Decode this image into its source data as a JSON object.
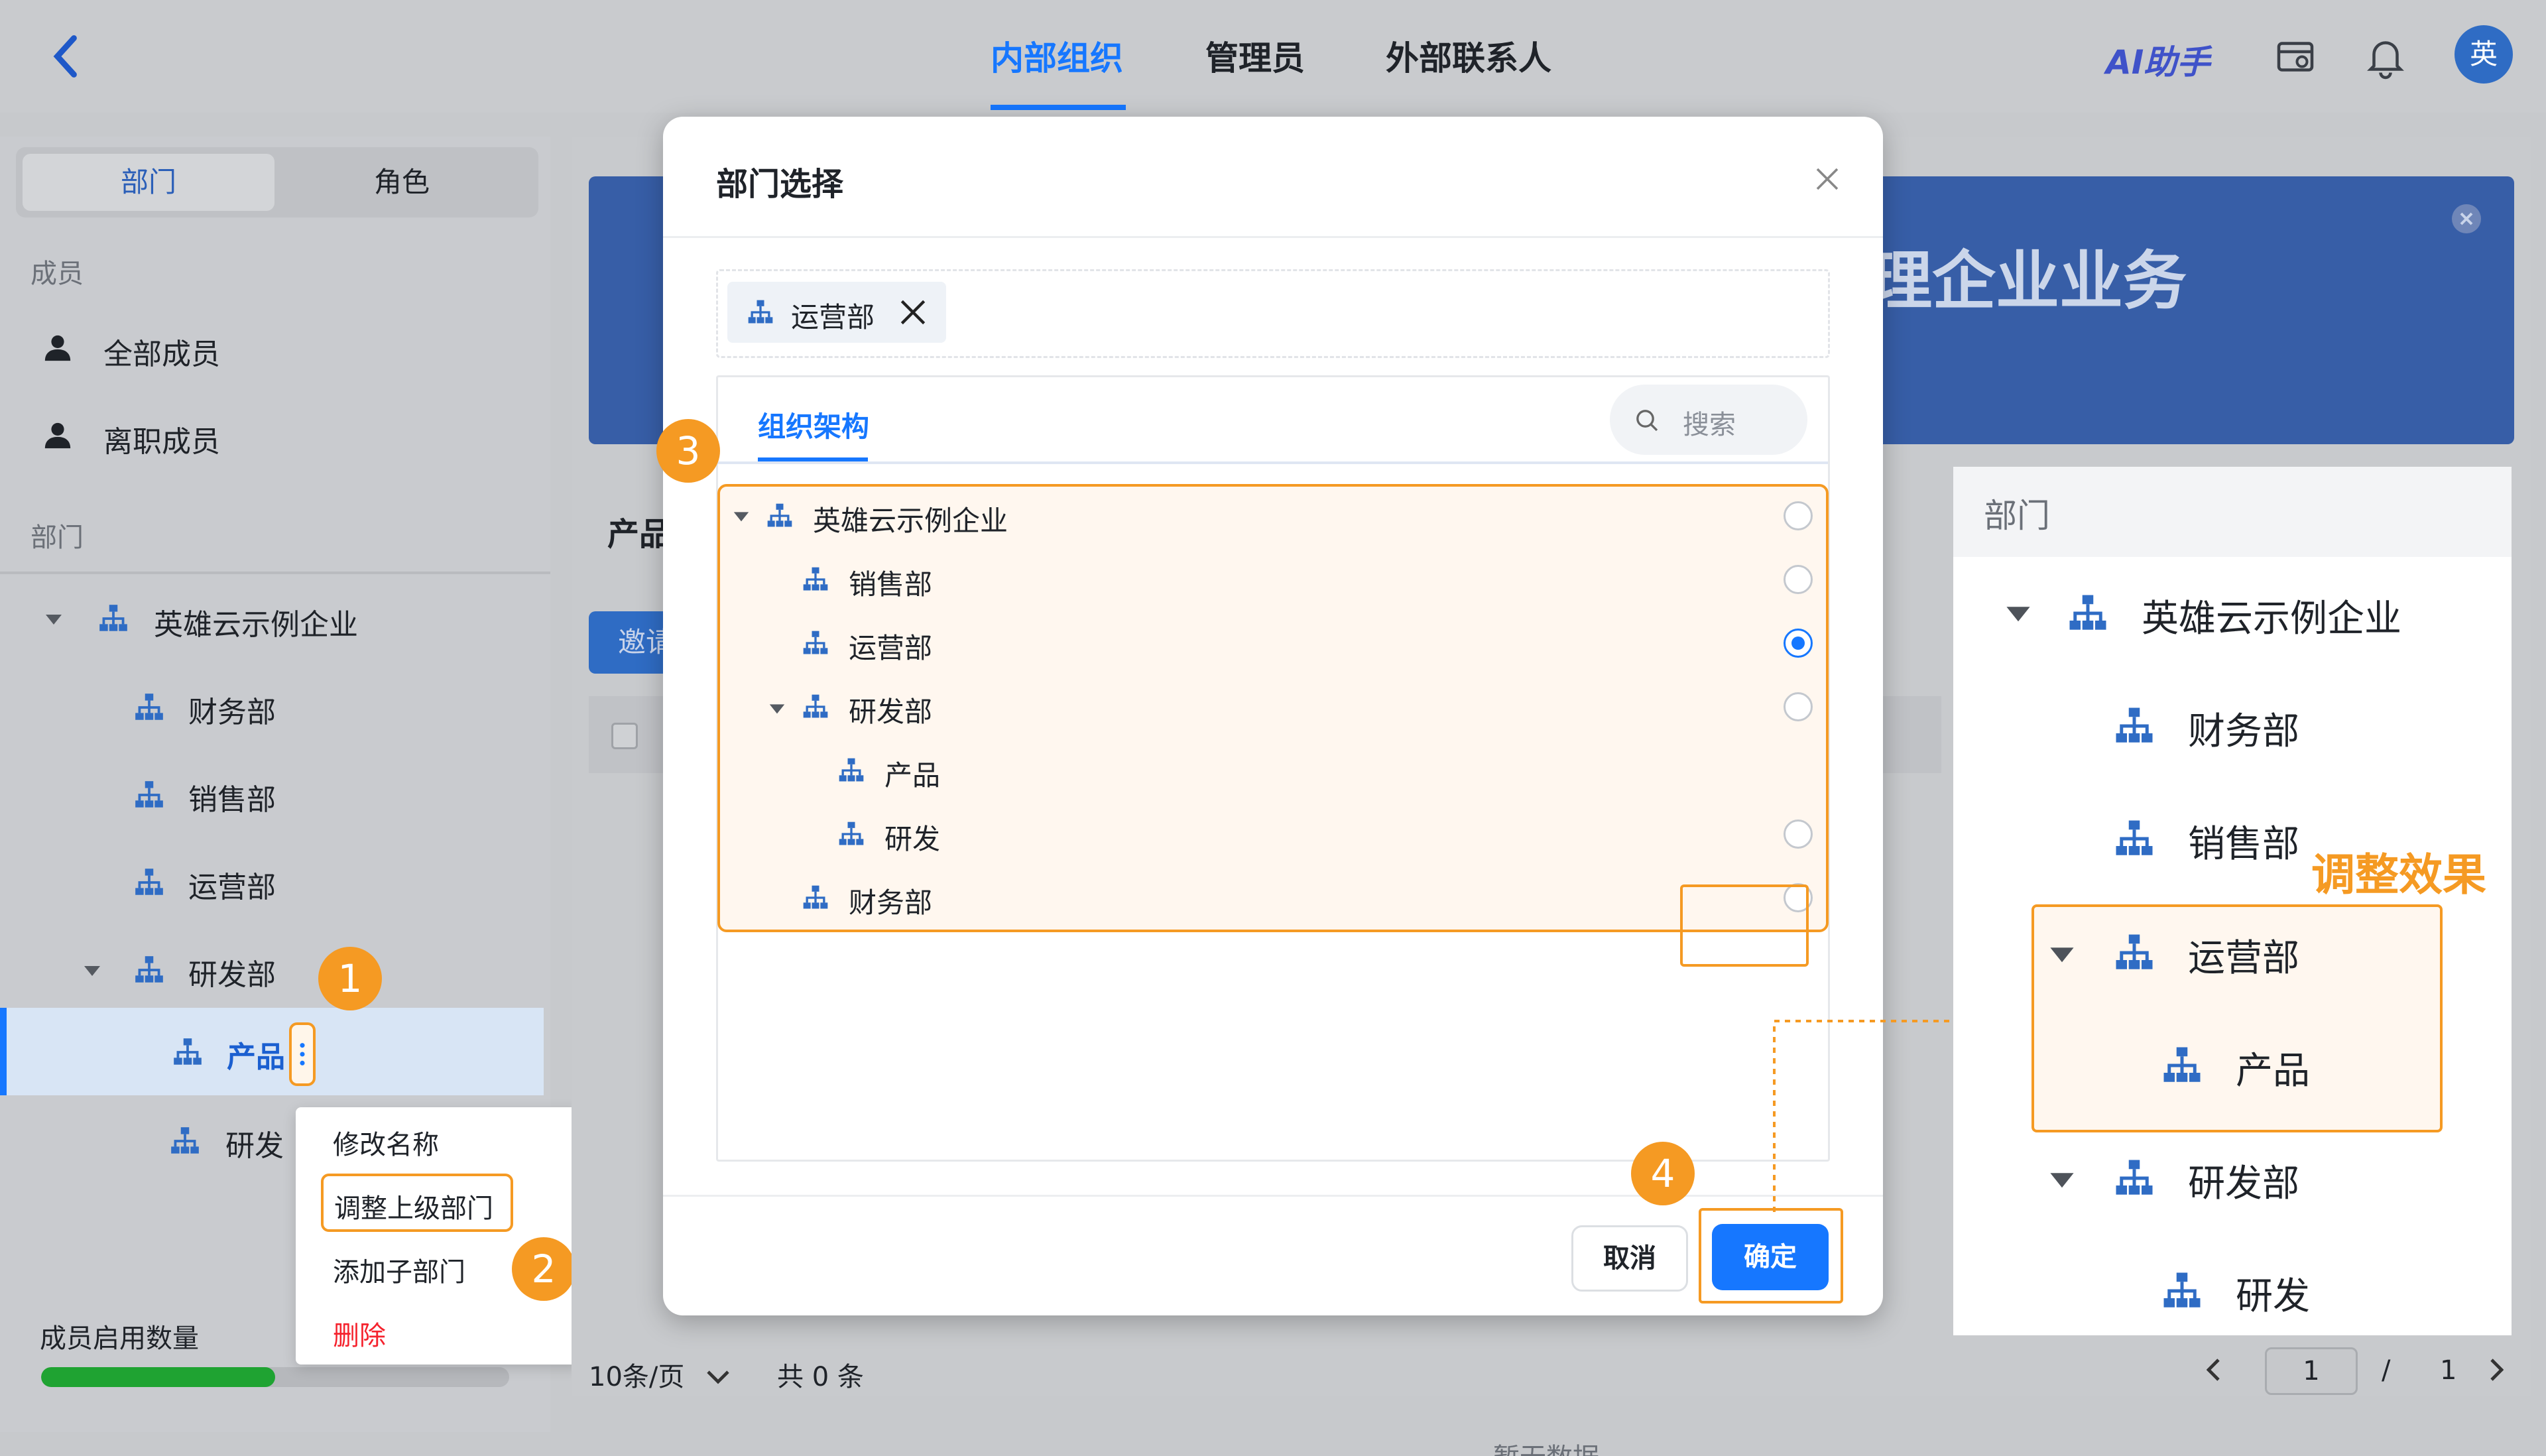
{
  "topbar": {
    "back": "back",
    "tabs": [
      "内部组织",
      "管理员",
      "外部联系人"
    ],
    "active_tab": 0,
    "ai": "AI助手",
    "avatar": "英"
  },
  "sidebar": {
    "seg": [
      "部门",
      "角色"
    ],
    "members_header": "成员",
    "members": [
      "全部成员",
      "离职成员"
    ],
    "dept_header": "部门",
    "tree": {
      "root": "英雄云示例企业",
      "children": [
        "财务部",
        "销售部",
        "运营部",
        "研发部"
      ],
      "rd_children": [
        "产品",
        "研发"
      ]
    },
    "menu": [
      "修改名称",
      "调整上级部门",
      "添加子部门",
      "删除"
    ],
    "usage_label": "成员启用数量",
    "usage_fraction": 0.5
  },
  "main": {
    "banner_text": "理企业业务",
    "title_partial": "产品",
    "invite_partial": "邀请",
    "empty_partial": "暂无数据",
    "page_size": "10条/页",
    "total": "共 0 条",
    "page_current": "1",
    "page_sep": "/",
    "page_total": "1"
  },
  "modal": {
    "title": "部门选择",
    "selected_tag": "运营部",
    "tab": "组织架构",
    "search_placeholder": "搜索",
    "tree": [
      {
        "label": "英雄云示例企业",
        "selected": false
      },
      {
        "label": "销售部",
        "selected": false
      },
      {
        "label": "运营部",
        "selected": true
      },
      {
        "label": "研发部",
        "selected": false
      },
      {
        "label": "产品",
        "selected": false
      },
      {
        "label": "研发",
        "selected": false
      },
      {
        "label": "财务部",
        "selected": false
      }
    ],
    "cancel": "取消",
    "confirm": "确定"
  },
  "steps": [
    "1",
    "2",
    "3",
    "4"
  ],
  "result": {
    "header": "部门",
    "rows": [
      "英雄云示例企业",
      "财务部",
      "销售部",
      "运营部",
      "产品",
      "研发部",
      "研发"
    ],
    "label": "调整效果"
  },
  "colors": {
    "accent": "#1677ff",
    "orange": "#f59a23",
    "danger": "#f5222d"
  }
}
